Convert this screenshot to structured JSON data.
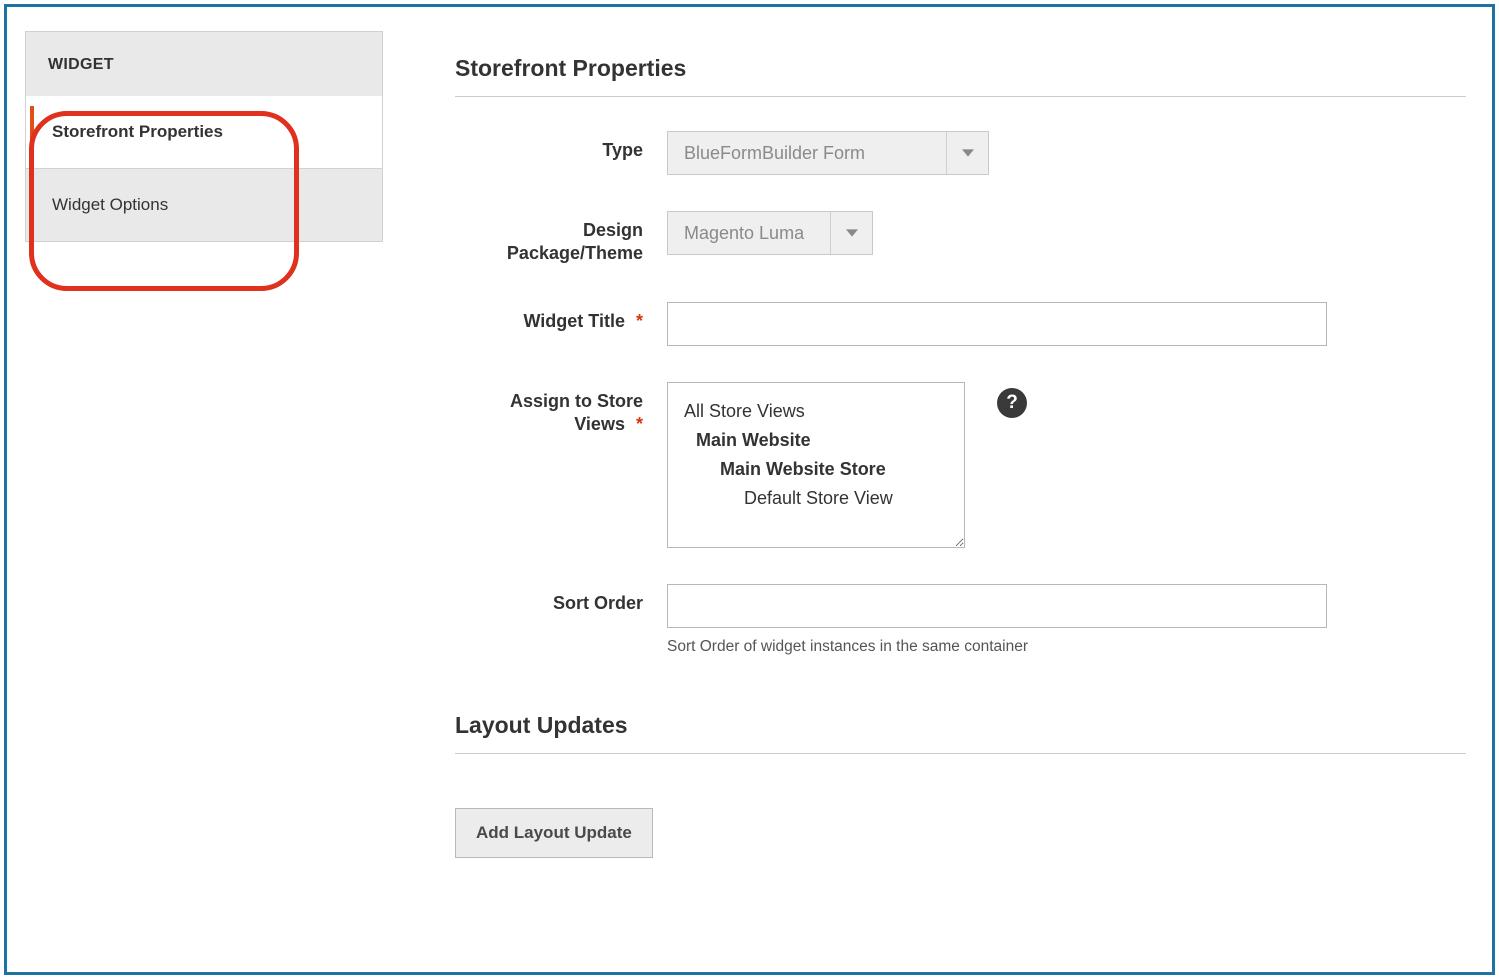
{
  "sidebar": {
    "header": "WIDGET",
    "items": [
      {
        "label": "Storefront Properties",
        "active": true
      },
      {
        "label": "Widget Options",
        "active": false
      }
    ]
  },
  "section1": {
    "title": "Storefront Properties",
    "fields": {
      "type": {
        "label": "Type",
        "value": "BlueFormBuilder Form"
      },
      "theme": {
        "label": "Design Package/Theme",
        "value": "Magento Luma"
      },
      "widgetTitle": {
        "label": "Widget Title",
        "value": ""
      },
      "storeViews": {
        "label": "Assign to Store Views",
        "options": {
          "all": "All Store Views",
          "site": "Main Website",
          "store": "Main Website Store",
          "view": "Default Store View"
        }
      },
      "sortOrder": {
        "label": "Sort Order",
        "value": "",
        "hint": "Sort Order of widget instances in the same container"
      }
    }
  },
  "section2": {
    "title": "Layout Updates",
    "addButton": "Add Layout Update"
  },
  "glyphs": {
    "required": "*",
    "help": "?"
  }
}
